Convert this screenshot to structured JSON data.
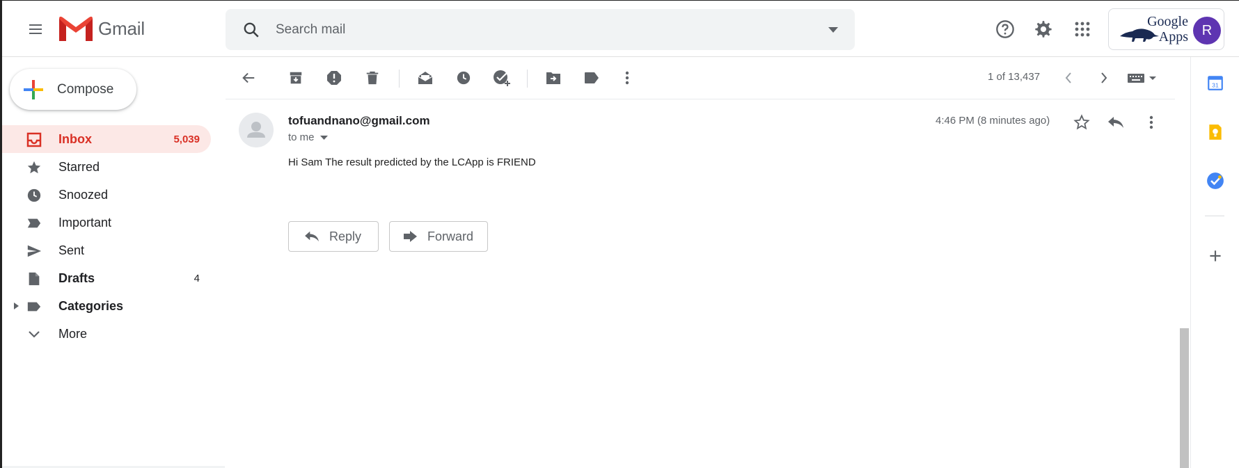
{
  "header": {
    "app_name": "Gmail",
    "search_placeholder": "Search mail",
    "account_logo_line1": "Google",
    "account_logo_line2": "Apps",
    "avatar_initial": "R"
  },
  "sidebar": {
    "compose_label": "Compose",
    "items": [
      {
        "label": "Inbox",
        "count": "5,039",
        "icon": "inbox-icon",
        "active": true
      },
      {
        "label": "Starred",
        "count": "",
        "icon": "star-icon"
      },
      {
        "label": "Snoozed",
        "count": "",
        "icon": "clock-icon"
      },
      {
        "label": "Important",
        "count": "",
        "icon": "important-icon"
      },
      {
        "label": "Sent",
        "count": "",
        "icon": "send-icon"
      },
      {
        "label": "Drafts",
        "count": "4",
        "icon": "draft-icon"
      },
      {
        "label": "Categories",
        "count": "",
        "icon": "label-icon"
      },
      {
        "label": "More",
        "count": "",
        "icon": "chevron-down-icon"
      }
    ]
  },
  "toolbar": {
    "pager_text": "1 of 13,437"
  },
  "message": {
    "sender": "tofuandnano@gmail.com",
    "recipient": "to me",
    "time": "4:46 PM (8 minutes ago)",
    "body": "Hi Sam The result predicted by the LCApp is FRIEND",
    "reply_label": "Reply",
    "forward_label": "Forward"
  },
  "colors": {
    "accent_red": "#d93025",
    "active_bg": "#fce8e6",
    "avatar_bg": "#5e35b1"
  }
}
